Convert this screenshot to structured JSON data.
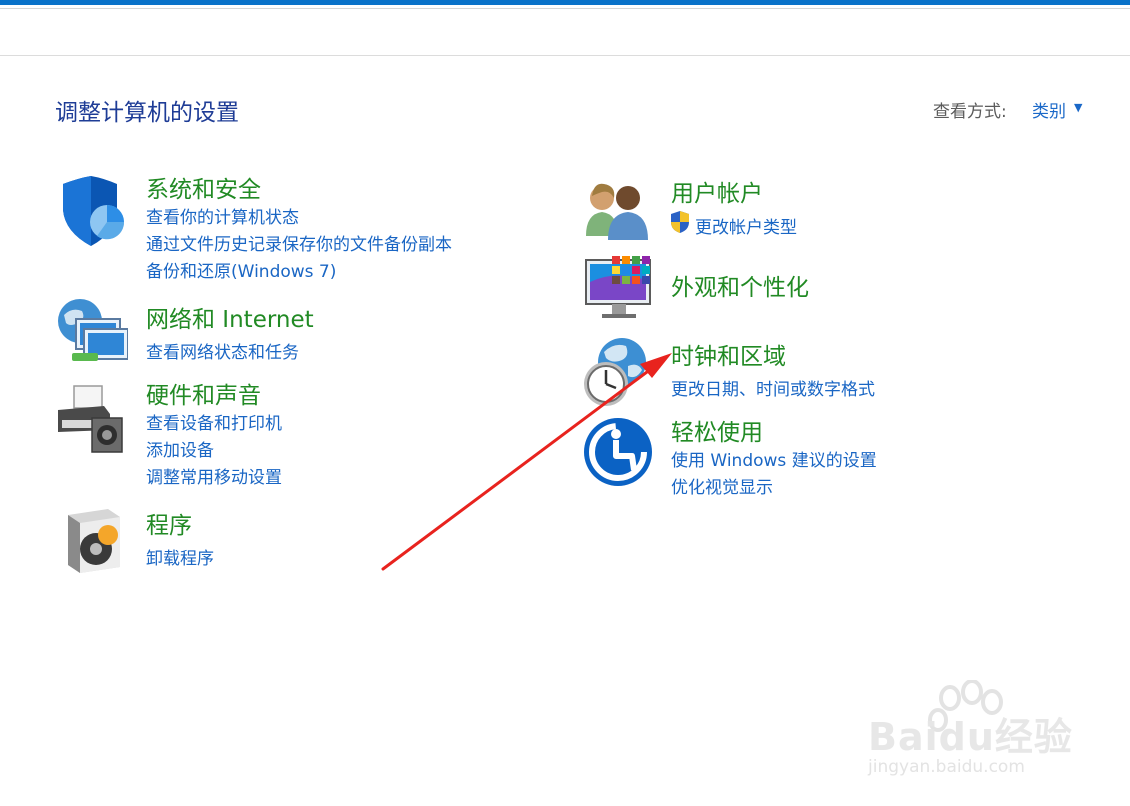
{
  "header": {
    "title": "调整计算机的设置"
  },
  "view": {
    "label": "查看方式:",
    "value": "类别"
  },
  "categories": {
    "system": {
      "title": "系统和安全",
      "links": [
        "查看你的计算机状态",
        "通过文件历史记录保存你的文件备份副本",
        "备份和还原(Windows 7)"
      ]
    },
    "network": {
      "title": "网络和 Internet",
      "links": [
        "查看网络状态和任务"
      ]
    },
    "hardware": {
      "title": "硬件和声音",
      "links": [
        "查看设备和打印机",
        "添加设备",
        "调整常用移动设置"
      ]
    },
    "programs": {
      "title": "程序",
      "links": [
        "卸载程序"
      ]
    },
    "users": {
      "title": "用户帐户",
      "links": [
        "更改帐户类型"
      ]
    },
    "appearance": {
      "title": "外观和个性化",
      "links": []
    },
    "clock": {
      "title": "时钟和区域",
      "links": [
        "更改日期、时间或数字格式"
      ]
    },
    "ease": {
      "title": "轻松使用",
      "links": [
        "使用 Windows 建议的设置",
        "优化视觉显示"
      ]
    }
  },
  "watermark": {
    "brand": "Baidu经验",
    "url": "jingyan.baidu.com"
  },
  "colors": {
    "accent": "#0a72c9",
    "category": "#218a24",
    "link": "#1a66c4",
    "annotation_arrow": "#e8231e"
  }
}
